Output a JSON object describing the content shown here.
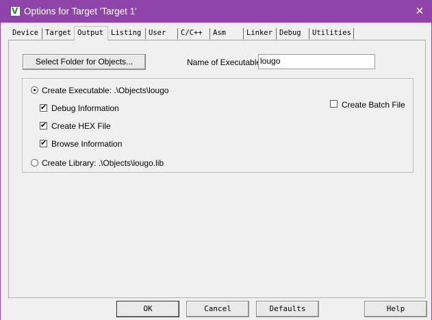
{
  "window": {
    "title": "Options for Target 'Target 1'",
    "app_icon": "keil-uvision-icon",
    "close_glyph": "✕",
    "title_color": "#8e44a8"
  },
  "tabs": [
    {
      "label": "Device"
    },
    {
      "label": "Target"
    },
    {
      "label": "Output",
      "active": true
    },
    {
      "label": "Listing"
    },
    {
      "label": "User"
    },
    {
      "label": "C/C++"
    },
    {
      "label": "Asm"
    },
    {
      "label": "Linker"
    },
    {
      "label": "Debug"
    },
    {
      "label": "Utilities"
    }
  ],
  "output": {
    "select_folder_label": "Select Folder for Objects...",
    "name_exec_label": "Name of Executable:",
    "name_exec_value": "lougo",
    "create_exec_label": "Create Executable:  .\\Objects\\lougo",
    "create_exec_selected": true,
    "debug_info_label": "Debug Information",
    "debug_info_checked": true,
    "create_hex_label": "Create HEX File",
    "create_hex_checked": true,
    "browse_info_label": "Browse Information",
    "browse_info_checked": true,
    "create_batch_label": "Create Batch File",
    "create_batch_checked": false,
    "create_lib_label": "Create Library:  .\\Objects\\lougo.lib",
    "create_lib_selected": false
  },
  "buttons": {
    "ok": "OK",
    "cancel": "Cancel",
    "defaults": "Defaults",
    "help": "Help"
  },
  "check_glyph": "✔"
}
